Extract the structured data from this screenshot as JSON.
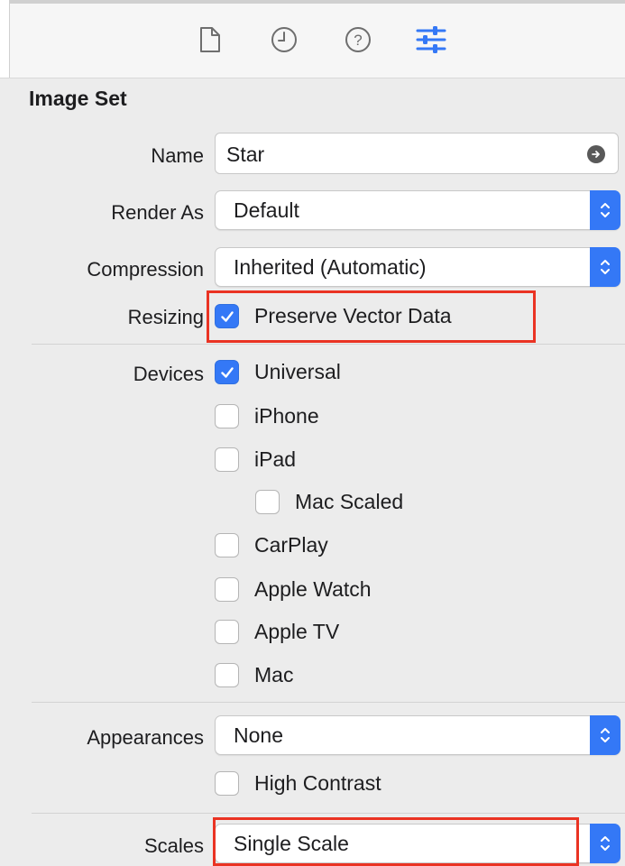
{
  "toolbar": {
    "tabs": [
      {
        "icon": "file-icon"
      },
      {
        "icon": "history-clock-icon"
      },
      {
        "icon": "help-question-icon"
      },
      {
        "icon": "attributes-sliders-icon",
        "selected": true
      }
    ],
    "accent": "#3478f6"
  },
  "section": {
    "title": "Image Set"
  },
  "fields": {
    "name": {
      "label": "Name",
      "value": "Star"
    },
    "render_as": {
      "label": "Render As",
      "value": "Default"
    },
    "compression": {
      "label": "Compression",
      "value": "Inherited (Automatic)"
    },
    "resizing": {
      "label": "Resizing",
      "option": "Preserve Vector Data",
      "checked": true
    },
    "devices": {
      "label": "Devices",
      "items": [
        {
          "label": "Universal",
          "checked": true
        },
        {
          "label": "iPhone",
          "checked": false
        },
        {
          "label": "iPad",
          "checked": false
        },
        {
          "label": "Mac Scaled",
          "checked": false
        },
        {
          "label": "CarPlay",
          "checked": false
        },
        {
          "label": "Apple Watch",
          "checked": false
        },
        {
          "label": "Apple TV",
          "checked": false
        },
        {
          "label": "Mac",
          "checked": false
        }
      ]
    },
    "appearances": {
      "label": "Appearances",
      "value": "None"
    },
    "high_contrast": {
      "label": "High Contrast",
      "checked": false
    },
    "scales": {
      "label": "Scales",
      "value": "Single Scale"
    }
  },
  "highlight_color": "#ea3323"
}
